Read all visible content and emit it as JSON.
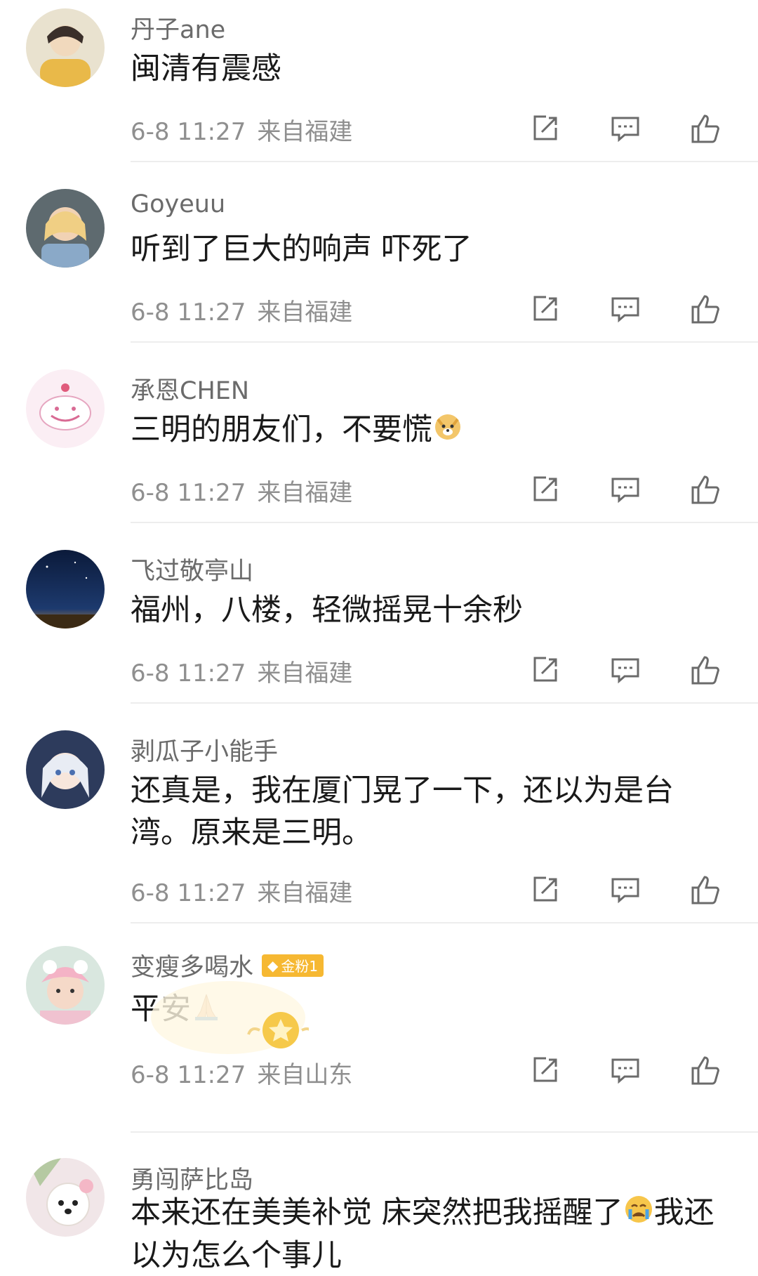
{
  "comments": [
    {
      "user": "丹子ane",
      "text": "闽清有震感",
      "time": "6-8 11:27",
      "location": "来自福建",
      "avatar": "avatar-girl-yellow"
    },
    {
      "user": "Goyeuu",
      "text": "听到了巨大的响声 吓死了",
      "time": "6-8 11:27",
      "location": "来自福建",
      "avatar": "avatar-child"
    },
    {
      "user": "承恩CHEN",
      "text": "三明的朋友们，不要慌",
      "emoji": "doge-emoji",
      "time": "6-8 11:27",
      "location": "来自福建",
      "avatar": "avatar-whale"
    },
    {
      "user": "飞过敬亭山",
      "text": "福州，八楼，轻微摇晃十余秒",
      "time": "6-8 11:27",
      "location": "来自福建",
      "avatar": "avatar-night-sky"
    },
    {
      "user": "剥瓜子小能手",
      "text": "还真是，我在厦门晃了一下，还以为是台湾。原来是三明。",
      "time": "6-8 11:27",
      "location": "来自福建",
      "avatar": "avatar-anime-girl"
    },
    {
      "user": "变瘦多喝水",
      "badge": "金粉1",
      "text": "平安",
      "emoji": "pray-emoji",
      "time": "6-8 11:27",
      "location": "来自山东",
      "avatar": "avatar-girl-hat"
    },
    {
      "user": "勇闯萨比岛",
      "text_1": "本来还在美美补觉 床突然把我摇醒了",
      "emoji": "crying-emoji",
      "text_2": "我还以为怎么个事儿",
      "avatar": "avatar-white-dog"
    }
  ],
  "actions": [
    "share-icon",
    "comment-icon",
    "like-icon"
  ]
}
